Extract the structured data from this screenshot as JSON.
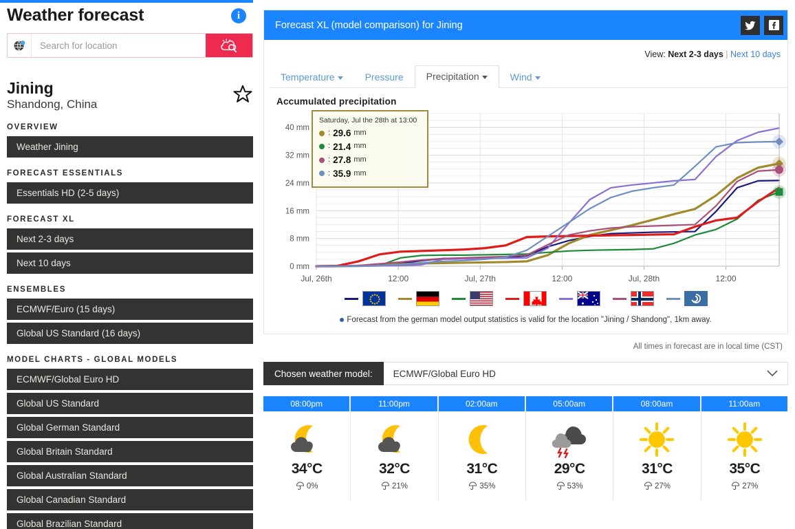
{
  "sidebar": {
    "title": "Weather forecast",
    "info_icon": "info-icon",
    "search": {
      "placeholder": "Search for location",
      "value": ""
    },
    "city": {
      "name": "Jining",
      "region": "Shandong, China"
    },
    "sections": [
      {
        "heading": "OVERVIEW",
        "items": [
          "Weather Jining"
        ]
      },
      {
        "heading": "FORECAST ESSENTIALS",
        "items": [
          "Essentials HD  (2-5 days)"
        ]
      },
      {
        "heading": "FORECAST XL",
        "items": [
          "Next 2-3 days",
          "Next 10 days"
        ]
      },
      {
        "heading": "ENSEMBLES",
        "items": [
          "ECMWF/Euro  (15 days)",
          "Global US Standard  (16 days)"
        ]
      },
      {
        "heading": "MODEL CHARTS - GLOBAL MODELS",
        "items": [
          "ECMWF/Global Euro HD",
          "Global US Standard",
          "Global German Standard",
          "Global Britain Standard",
          "Global Australian Standard",
          "Global Canadian Standard",
          "Global Brazilian Standard"
        ]
      }
    ]
  },
  "card": {
    "header_title": "Forecast XL  (model comparison) for Jining",
    "social": [
      {
        "name": "twitter-icon",
        "label": "Twitter"
      },
      {
        "name": "facebook-icon",
        "label": "Facebook"
      }
    ],
    "view": {
      "label": "View:",
      "current": "Next 2-3 days",
      "separator": "|",
      "alt": "Next 10 days"
    },
    "tabs": [
      {
        "label": "Temperature",
        "active": false,
        "has_caret": true
      },
      {
        "label": "Pressure",
        "active": false,
        "has_caret": false
      },
      {
        "label": "Precipitation",
        "active": true,
        "has_caret": true
      },
      {
        "label": "Wind",
        "active": false,
        "has_caret": true
      }
    ],
    "footnote": "Forecast from the german model output statistics is valid for the location \"Jining / Shandong\", 1km away.",
    "times_note": "All times in forecast are in local time  (CST)"
  },
  "chart_data": {
    "type": "line",
    "title": "Accumulated precipitation",
    "xlabel": "",
    "ylabel": "mm",
    "ylim": [
      0,
      44
    ],
    "yticks": [
      0,
      8,
      16,
      24,
      32,
      40
    ],
    "ytick_labels": [
      "0 mm",
      "8 mm",
      "16 mm",
      "24 mm",
      "32 mm",
      "40 mm"
    ],
    "xtick_labels": [
      "Jul, 26th",
      "12:00",
      "Jul, 27th",
      "12:00",
      "Jul, 28th",
      "12:00"
    ],
    "grid": true,
    "legend_position": "below",
    "x": [
      0,
      3,
      6,
      9,
      12,
      15,
      18,
      21,
      24,
      27,
      30,
      33,
      36,
      39,
      42,
      45,
      48,
      51,
      54,
      57,
      60,
      63,
      66
    ],
    "series": [
      {
        "name": "ECMWF/Euro",
        "flag": "eu",
        "color": "#1a1a7a",
        "values": [
          0,
          0,
          0.2,
          0.5,
          0.8,
          1.6,
          2.2,
          2.3,
          2.4,
          2.5,
          3.0,
          5.6,
          7.4,
          8.6,
          9.4,
          9.6,
          9.8,
          9.9,
          10.0,
          15.8,
          22.6,
          24.6,
          24.7
        ]
      },
      {
        "name": "Global German Standard",
        "flag": "de",
        "color": "#a08a2c",
        "values": [
          0,
          0,
          0.1,
          0.3,
          0.6,
          0.8,
          0.9,
          1.0,
          1.1,
          1.2,
          1.4,
          3.2,
          6.6,
          9.0,
          10.4,
          11.8,
          13.4,
          15.0,
          16.5,
          20.4,
          25.4,
          28.4,
          29.6
        ]
      },
      {
        "name": "Global US Standard",
        "flag": "us",
        "color": "#1f8a3a",
        "values": [
          0,
          0,
          0.1,
          0.2,
          2.4,
          3.1,
          3.2,
          3.2,
          3.3,
          3.4,
          3.5,
          4.0,
          4.4,
          4.6,
          4.7,
          4.8,
          5.0,
          6.6,
          9.0,
          10.6,
          13.6,
          19.0,
          21.4
        ]
      },
      {
        "name": "Global Canadian Standard",
        "flag": "ca",
        "color": "#e01b1b",
        "values": [
          0,
          0.1,
          1.4,
          3.4,
          4.2,
          4.4,
          4.6,
          4.8,
          5.2,
          6.0,
          8.4,
          8.6,
          8.7,
          8.8,
          8.9,
          9.0,
          9.1,
          9.2,
          11.4,
          13.2,
          14.0,
          18.6,
          22.6
        ]
      },
      {
        "name": "Global Australian Standard",
        "flag": "au",
        "color": "#8a6fd4",
        "values": [
          0,
          0,
          0,
          0.1,
          0.2,
          0.4,
          2.0,
          2.1,
          2.2,
          2.3,
          2.4,
          5.2,
          12.4,
          19.2,
          22.6,
          23.4,
          24.0,
          24.6,
          25.0,
          31.6,
          36.2,
          38.6,
          39.8
        ]
      },
      {
        "name": "Global Norwegian Standard",
        "flag": "no",
        "color": "#a8507a",
        "values": [
          0,
          0,
          0.2,
          0.7,
          1.2,
          1.8,
          2.2,
          2.4,
          2.6,
          2.8,
          3.2,
          6.2,
          9.0,
          10.2,
          11.0,
          11.4,
          11.6,
          11.8,
          12.0,
          17.4,
          24.4,
          27.4,
          27.8
        ]
      },
      {
        "name": "MOS",
        "flag": "mos",
        "color": "#6f8fc0",
        "values": [
          0,
          0,
          0,
          0.2,
          0.5,
          1.0,
          1.4,
          1.6,
          2.0,
          2.6,
          4.6,
          8.6,
          12.6,
          16.6,
          19.8,
          21.6,
          22.6,
          23.4,
          28.8,
          34.4,
          35.6,
          35.8,
          35.9
        ]
      }
    ],
    "cursor": {
      "x_index": 22,
      "label": "12:00 Jul 28th"
    },
    "tooltip": {
      "header": "Saturday, Jul the 28th at 13:00",
      "rows": [
        {
          "color": "#a08a2c",
          "value": "29.6",
          "unit": "mm"
        },
        {
          "color": "#1f8a3a",
          "value": "21.4",
          "unit": "mm"
        },
        {
          "color": "#a8507a",
          "value": "27.8",
          "unit": "mm"
        },
        {
          "color": "#6f8fc0",
          "value": "35.9",
          "unit": "mm"
        }
      ]
    },
    "legend": [
      {
        "flag": "eu",
        "color": "#1a1a7a"
      },
      {
        "flag": "de",
        "color": "#a08a2c"
      },
      {
        "flag": "us",
        "color": "#1f8a3a"
      },
      {
        "flag": "ca",
        "color": "#e01b1b"
      },
      {
        "flag": "au",
        "color": "#8a6fd4"
      },
      {
        "flag": "no",
        "color": "#a8507a"
      },
      {
        "flag": "mos",
        "color": "#6f8fc0"
      }
    ]
  },
  "model_selector": {
    "label": "Chosen weather model:",
    "value": "ECMWF/Global Euro HD"
  },
  "hours": [
    {
      "time": "08:00pm",
      "icon": "moon-cloud-icon",
      "temp": "34°C",
      "rain": "0%"
    },
    {
      "time": "11:00pm",
      "icon": "moon-cloud-icon",
      "temp": "32°C",
      "rain": "21%"
    },
    {
      "time": "02:00am",
      "icon": "moon-icon",
      "temp": "31°C",
      "rain": "35%"
    },
    {
      "time": "05:00am",
      "icon": "thunderstorm-icon",
      "temp": "29°C",
      "rain": "53%"
    },
    {
      "time": "08:00am",
      "icon": "sun-icon",
      "temp": "31°C",
      "rain": "27%"
    },
    {
      "time": "11:00am",
      "icon": "sun-icon",
      "temp": "35°C",
      "rain": "27%"
    }
  ],
  "colors": {
    "accent_blue": "#1a85ff",
    "accent_red": "#ee2a4e",
    "dark": "#333333"
  }
}
